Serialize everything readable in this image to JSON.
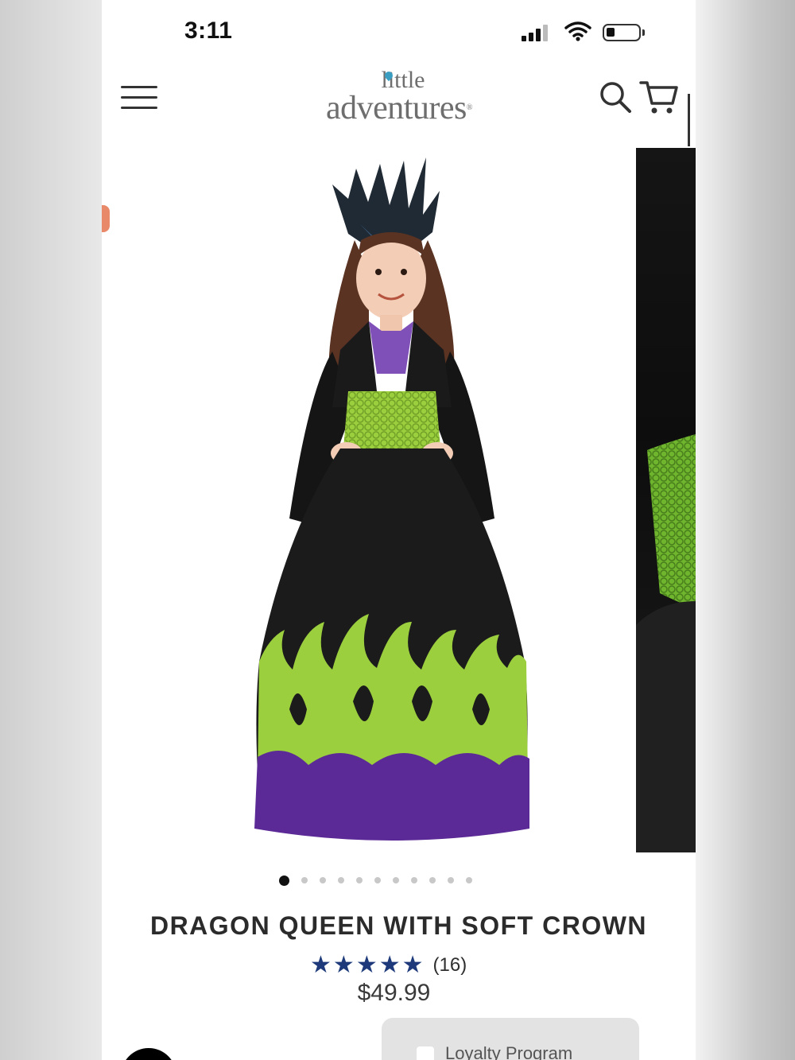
{
  "status_bar": {
    "time": "3:11"
  },
  "header": {
    "logo_top": "little",
    "logo_bottom": "adventures",
    "logo_mark": "®"
  },
  "carousel": {
    "slide_count": 11,
    "active_slide": 1
  },
  "product": {
    "title": "DRAGON QUEEN WITH SOFT CROWN",
    "rating": 5,
    "stars": [
      "★",
      "★",
      "★",
      "★",
      "★"
    ],
    "review_count": "(16)",
    "price": "$49.99"
  },
  "loyalty": {
    "label": "Loyalty Program"
  },
  "colors": {
    "accent_star": "#1e3a7a",
    "dress_green": "#9ccf3e",
    "dress_purple": "#5b2a96"
  }
}
